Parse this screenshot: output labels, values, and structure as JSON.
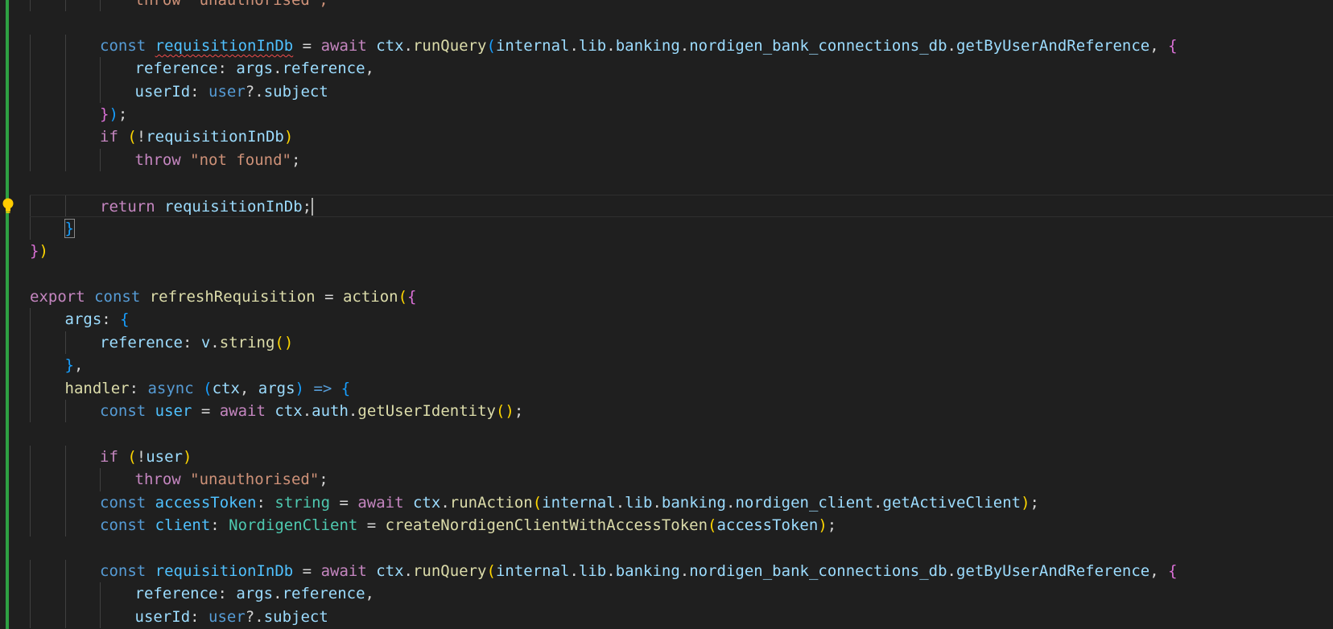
{
  "editor": {
    "language": "typescript",
    "colors": {
      "background": "#1f1f1f",
      "git_gutter_added": "#2ea043",
      "keyword_control": "#c586c0",
      "keyword_storage": "#569cd6",
      "variable": "#9cdcfe",
      "constant": "#4fc1ff",
      "function": "#dcdcaa",
      "type": "#4ec9b0",
      "string": "#ce9178",
      "bracket_level_1": "#ffd700",
      "bracket_level_2": "#da70d6",
      "bracket_level_3": "#179fff"
    },
    "lightbulb_icon": "lightbulb-icon",
    "lines": [
      {
        "indent": 3,
        "tokens": [
          [
            "str",
            "throw \"unauthorised\";"
          ]
        ],
        "partial": true
      },
      {
        "indent": 0,
        "tokens": []
      },
      {
        "indent": 2,
        "tokens": [
          [
            "st",
            "const "
          ],
          [
            "cst squiggle",
            "requisitionInDb"
          ],
          [
            "pun",
            " = "
          ],
          [
            "kw",
            "await "
          ],
          [
            "var",
            "ctx"
          ],
          [
            "pun",
            "."
          ],
          [
            "fn",
            "runQuery"
          ],
          [
            "b3",
            "("
          ],
          [
            "var",
            "internal"
          ],
          [
            "pun",
            "."
          ],
          [
            "var",
            "lib"
          ],
          [
            "pun",
            "."
          ],
          [
            "var",
            "banking"
          ],
          [
            "pun",
            "."
          ],
          [
            "var",
            "nordigen_bank_connections_db"
          ],
          [
            "pun",
            "."
          ],
          [
            "var",
            "getByUserAndReference"
          ],
          [
            "pun",
            ", "
          ],
          [
            "b2",
            "{"
          ]
        ]
      },
      {
        "indent": 3,
        "tokens": [
          [
            "var",
            "reference"
          ],
          [
            "pun",
            ": "
          ],
          [
            "var",
            "args"
          ],
          [
            "pun",
            "."
          ],
          [
            "var",
            "reference"
          ],
          [
            "pun",
            ","
          ]
        ]
      },
      {
        "indent": 3,
        "tokens": [
          [
            "var",
            "userId"
          ],
          [
            "pun",
            ": "
          ],
          [
            "st",
            "user"
          ],
          [
            "pun",
            "?."
          ],
          [
            "var",
            "subject"
          ]
        ]
      },
      {
        "indent": 2,
        "tokens": [
          [
            "b2",
            "}"
          ],
          [
            "b3",
            ")"
          ],
          [
            "pun",
            ";"
          ]
        ]
      },
      {
        "indent": 2,
        "tokens": [
          [
            "kw",
            "if "
          ],
          [
            "b1",
            "("
          ],
          [
            "pun",
            "!"
          ],
          [
            "var",
            "requisitionInDb"
          ],
          [
            "b1",
            ")"
          ]
        ]
      },
      {
        "indent": 3,
        "tokens": [
          [
            "kw",
            "throw "
          ],
          [
            "str",
            "\"not found\""
          ],
          [
            "pun",
            ";"
          ]
        ]
      },
      {
        "indent": 0,
        "tokens": []
      },
      {
        "indent": 2,
        "tokens": [
          [
            "kw",
            "return "
          ],
          [
            "var",
            "requisitionInDb"
          ],
          [
            "pun",
            ";"
          ]
        ],
        "current": true,
        "lightbulb": true,
        "cursor": true
      },
      {
        "indent": 1,
        "tokens": [
          [
            "b3 bracket-box",
            "}"
          ]
        ]
      },
      {
        "indent": 0,
        "tokens": [
          [
            "b2",
            "}"
          ],
          [
            "b1",
            ")"
          ]
        ]
      },
      {
        "indent": 0,
        "tokens": []
      },
      {
        "indent": 0,
        "tokens": [
          [
            "kw",
            "export "
          ],
          [
            "st",
            "const "
          ],
          [
            "fn",
            "refreshRequisition"
          ],
          [
            "pun",
            " = "
          ],
          [
            "fn",
            "action"
          ],
          [
            "b1",
            "("
          ],
          [
            "b2",
            "{"
          ]
        ]
      },
      {
        "indent": 1,
        "tokens": [
          [
            "var",
            "args"
          ],
          [
            "pun",
            ": "
          ],
          [
            "b3",
            "{"
          ]
        ]
      },
      {
        "indent": 2,
        "tokens": [
          [
            "var",
            "reference"
          ],
          [
            "pun",
            ": "
          ],
          [
            "var",
            "v"
          ],
          [
            "pun",
            "."
          ],
          [
            "fn",
            "string"
          ],
          [
            "b1",
            "()"
          ]
        ]
      },
      {
        "indent": 1,
        "tokens": [
          [
            "b3",
            "}"
          ],
          [
            "pun",
            ","
          ]
        ]
      },
      {
        "indent": 1,
        "tokens": [
          [
            "fn",
            "handler"
          ],
          [
            "pun",
            ": "
          ],
          [
            "st",
            "async "
          ],
          [
            "b3",
            "("
          ],
          [
            "var",
            "ctx"
          ],
          [
            "pun",
            ", "
          ],
          [
            "var",
            "args"
          ],
          [
            "b3",
            ")"
          ],
          [
            "st",
            " => "
          ],
          [
            "b3",
            "{"
          ]
        ]
      },
      {
        "indent": 2,
        "tokens": [
          [
            "st",
            "const "
          ],
          [
            "cst",
            "user"
          ],
          [
            "pun",
            " = "
          ],
          [
            "kw",
            "await "
          ],
          [
            "var",
            "ctx"
          ],
          [
            "pun",
            "."
          ],
          [
            "var",
            "auth"
          ],
          [
            "pun",
            "."
          ],
          [
            "fn",
            "getUserIdentity"
          ],
          [
            "b1",
            "()"
          ],
          [
            "pun",
            ";"
          ]
        ]
      },
      {
        "indent": 0,
        "tokens": []
      },
      {
        "indent": 2,
        "tokens": [
          [
            "kw",
            "if "
          ],
          [
            "b1",
            "("
          ],
          [
            "pun",
            "!"
          ],
          [
            "var",
            "user"
          ],
          [
            "b1",
            ")"
          ]
        ]
      },
      {
        "indent": 3,
        "tokens": [
          [
            "kw",
            "throw "
          ],
          [
            "str",
            "\"unauthorised\""
          ],
          [
            "pun",
            ";"
          ]
        ]
      },
      {
        "indent": 2,
        "tokens": [
          [
            "st",
            "const "
          ],
          [
            "cst",
            "accessToken"
          ],
          [
            "pun",
            ": "
          ],
          [
            "type",
            "string"
          ],
          [
            "pun",
            " = "
          ],
          [
            "kw",
            "await "
          ],
          [
            "var",
            "ctx"
          ],
          [
            "pun",
            "."
          ],
          [
            "fn",
            "runAction"
          ],
          [
            "b1",
            "("
          ],
          [
            "var",
            "internal"
          ],
          [
            "pun",
            "."
          ],
          [
            "var",
            "lib"
          ],
          [
            "pun",
            "."
          ],
          [
            "var",
            "banking"
          ],
          [
            "pun",
            "."
          ],
          [
            "var",
            "nordigen_client"
          ],
          [
            "pun",
            "."
          ],
          [
            "var",
            "getActiveClient"
          ],
          [
            "b1",
            ")"
          ],
          [
            "pun",
            ";"
          ]
        ]
      },
      {
        "indent": 2,
        "tokens": [
          [
            "st",
            "const "
          ],
          [
            "cst",
            "client"
          ],
          [
            "pun",
            ": "
          ],
          [
            "type",
            "NordigenClient"
          ],
          [
            "pun",
            " = "
          ],
          [
            "fn",
            "createNordigenClientWithAccessToken"
          ],
          [
            "b1",
            "("
          ],
          [
            "var",
            "accessToken"
          ],
          [
            "b1",
            ")"
          ],
          [
            "pun",
            ";"
          ]
        ]
      },
      {
        "indent": 0,
        "tokens": []
      },
      {
        "indent": 2,
        "tokens": [
          [
            "st",
            "const "
          ],
          [
            "cst",
            "requisitionInDb"
          ],
          [
            "pun",
            " = "
          ],
          [
            "kw",
            "await "
          ],
          [
            "var",
            "ctx"
          ],
          [
            "pun",
            "."
          ],
          [
            "fn",
            "runQuery"
          ],
          [
            "b1",
            "("
          ],
          [
            "var",
            "internal"
          ],
          [
            "pun",
            "."
          ],
          [
            "var",
            "lib"
          ],
          [
            "pun",
            "."
          ],
          [
            "var",
            "banking"
          ],
          [
            "pun",
            "."
          ],
          [
            "var",
            "nordigen_bank_connections_db"
          ],
          [
            "pun",
            "."
          ],
          [
            "var",
            "getByUserAndReference"
          ],
          [
            "pun",
            ", "
          ],
          [
            "b2",
            "{"
          ]
        ]
      },
      {
        "indent": 3,
        "tokens": [
          [
            "var",
            "reference"
          ],
          [
            "pun",
            ": "
          ],
          [
            "var",
            "args"
          ],
          [
            "pun",
            "."
          ],
          [
            "var",
            "reference"
          ],
          [
            "pun",
            ","
          ]
        ]
      },
      {
        "indent": 3,
        "tokens": [
          [
            "var",
            "userId"
          ],
          [
            "pun",
            ": "
          ],
          [
            "st",
            "user"
          ],
          [
            "pun",
            "?."
          ],
          [
            "var",
            "subject"
          ]
        ]
      }
    ]
  }
}
